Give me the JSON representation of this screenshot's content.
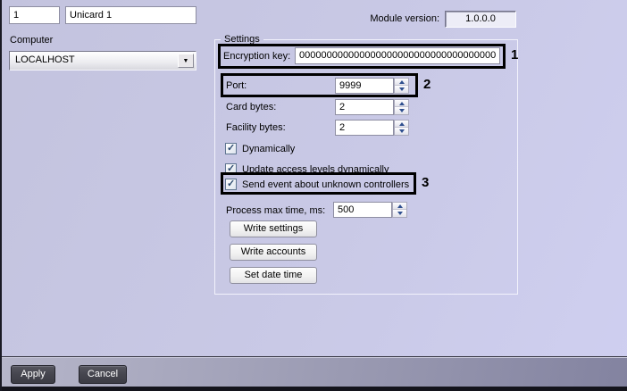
{
  "header": {
    "id_value": "1",
    "name_value": "Unicard 1",
    "computer_label": "Computer",
    "computer_value": "LOCALHOST",
    "module_version_label": "Module version:",
    "module_version_value": "1.0.0.0"
  },
  "settings": {
    "group_label": "Settings",
    "encryption": {
      "label": "Encryption key:",
      "value": "000000000000000000000000000000000000",
      "annotation": "1"
    },
    "port": {
      "label": "Port:",
      "value": "9999",
      "annotation": "2"
    },
    "card_bytes": {
      "label": "Card bytes:",
      "value": "2"
    },
    "facility_bytes": {
      "label": "Facility bytes:",
      "value": "2"
    },
    "checkboxes": [
      {
        "label": "Dynamically",
        "checked": true
      },
      {
        "label": "Update access levels dynamically",
        "checked": true
      },
      {
        "label": "Send event about unknown controllers",
        "checked": true,
        "annotation": "3"
      }
    ],
    "process_max_time": {
      "label": "Process max time, ms:",
      "value": "500"
    },
    "buttons": [
      {
        "label": "Write settings"
      },
      {
        "label": "Write accounts"
      },
      {
        "label": "Set date time"
      }
    ]
  },
  "footer": {
    "apply_label": "Apply",
    "cancel_label": "Cancel"
  },
  "icons": {
    "checkmark": "✓",
    "dropdown_arrow": "▼"
  },
  "colors": {
    "background": "#c8c8e5",
    "footer_strip": "#9a9ab2",
    "dark_button": "#45454e",
    "annotation_border": "#000000",
    "spin_arrow": "#2f4f8f"
  }
}
